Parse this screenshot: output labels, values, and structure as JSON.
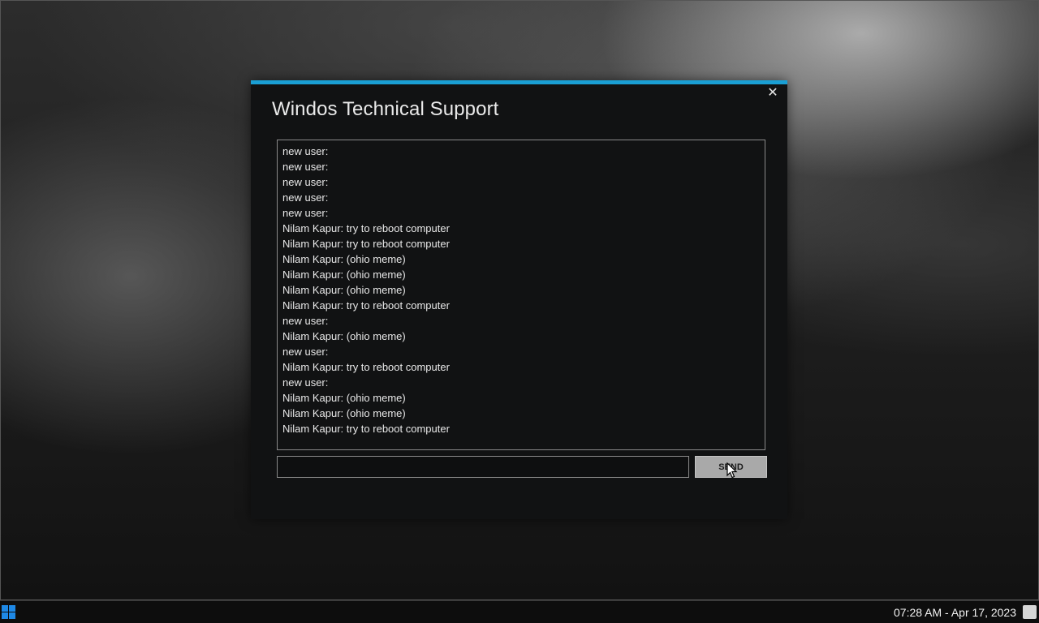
{
  "window": {
    "title": "Windos Technical Support",
    "close_label": "✕"
  },
  "chat": {
    "messages": [
      "new user:",
      "new user:",
      "new user:",
      "new user:",
      "new user:",
      "Nilam Kapur: try to reboot computer",
      "Nilam Kapur: try to reboot computer",
      "Nilam Kapur: (ohio meme)",
      "Nilam Kapur: (ohio meme)",
      "Nilam Kapur: (ohio meme)",
      "Nilam Kapur: try to reboot computer",
      "new user:",
      "Nilam Kapur: (ohio meme)",
      "new user:",
      "Nilam Kapur: try to reboot computer",
      "new user:",
      "Nilam Kapur: (ohio meme)",
      "Nilam Kapur: (ohio meme)",
      "Nilam Kapur: try to reboot computer"
    ],
    "input_value": "",
    "send_label": "SEND"
  },
  "taskbar": {
    "clock": "07:28 AM - Apr 17, 2023",
    "start_icon": "windows-logo-icon",
    "user_icon": "user-icon"
  },
  "colors": {
    "accent": "#1a9fd4",
    "window_bg": "#111213",
    "send_button_bg": "#a9a9a9"
  }
}
